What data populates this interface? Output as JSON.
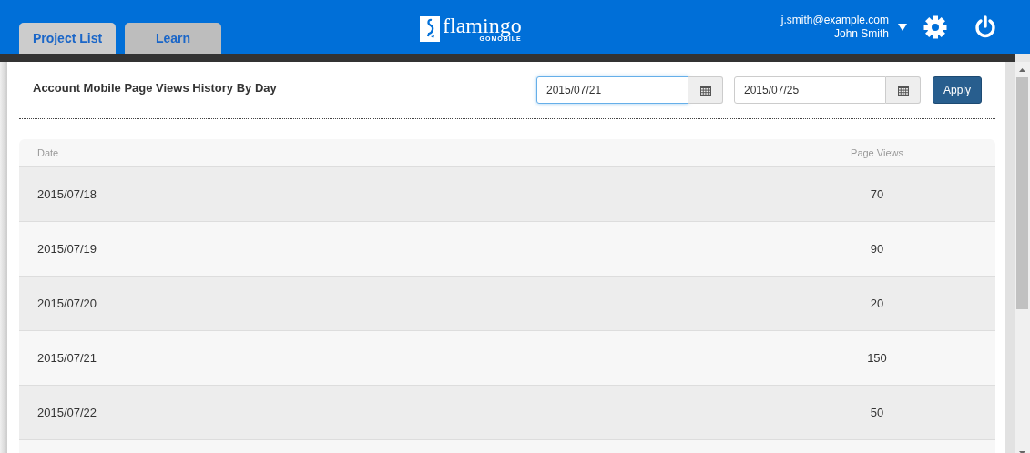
{
  "header": {
    "tabs": [
      {
        "label": "Project List",
        "selected": true
      },
      {
        "label": "Learn",
        "selected": false
      }
    ],
    "logo": {
      "name": "flamingo",
      "tagline": "GOMOBILE"
    },
    "user": {
      "email": "j.smith@example.com",
      "name": "John Smith"
    }
  },
  "report": {
    "title": "Account Mobile Page Views History By Day",
    "date_fields": [
      {
        "value": "2015/07/21",
        "focused": true
      },
      {
        "value": "2015/07/25",
        "focused": false
      }
    ],
    "apply_button": "Apply"
  },
  "table": {
    "columns": [
      "Date",
      "Page Views"
    ],
    "rows": [
      [
        "2015/07/18",
        "70"
      ],
      [
        "2015/07/19",
        "90"
      ],
      [
        "2015/07/20",
        "20"
      ],
      [
        "2015/07/21",
        "150"
      ],
      [
        "2015/07/22",
        "50"
      ]
    ]
  }
}
